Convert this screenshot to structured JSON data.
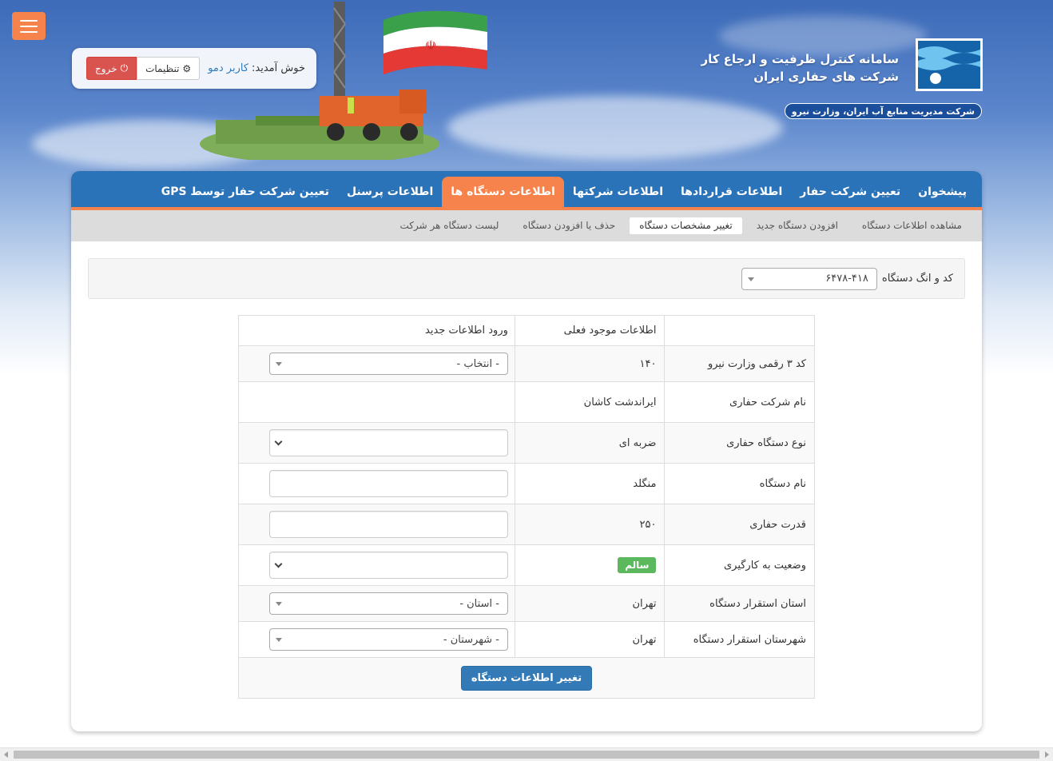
{
  "header": {
    "site_title_line1": "سامانه کنترل ظرفیت و ارجاع کار",
    "site_title_line2": "شرکت های حفاری ایران",
    "org_badge": "شرکت مدیریت منابع آب ایران، وزارت نیرو",
    "welcome_label": "خوش آمدید:",
    "user_name": "کاربر دمو",
    "settings_label": "تنظیمات",
    "exit_label": "خروج"
  },
  "nav": {
    "items": [
      {
        "label": "پیشخوان"
      },
      {
        "label": "تعیین شرکت حفار"
      },
      {
        "label": "اطلاعات قراردادها"
      },
      {
        "label": "اطلاعات شرکتها"
      },
      {
        "label": "اطلاعات دستگاه ها"
      },
      {
        "label": "اطلاعات پرسنل"
      },
      {
        "label": "تعیین شرکت حفار توسط GPS"
      }
    ],
    "active_index": 4
  },
  "subnav": {
    "items": [
      {
        "label": "مشاهده اطلاعات دستگاه"
      },
      {
        "label": "افزودن دستگاه جدید"
      },
      {
        "label": "تغییر مشخصات دستگاه"
      },
      {
        "label": "حذف یا افزودن دستگاه"
      },
      {
        "label": "لیست دستگاه هر شرکت"
      }
    ],
    "active_index": 2
  },
  "device_select": {
    "label": "کد و انگ دستگاه",
    "value": "۶۴۷۸-۴۱۸"
  },
  "table": {
    "headers": {
      "field": "",
      "current": "اطلاعات موجود فعلی",
      "new": "ورود اطلاعات جدید"
    },
    "rows": [
      {
        "field": "کد ۳ رقمی وزارت نیرو",
        "current": "۱۴۰",
        "input": "select",
        "placeholder": "- انتخاب -"
      },
      {
        "field": "نام شرکت حفاری",
        "current": "ایراندشت کاشان",
        "input": "none"
      },
      {
        "field": "نوع دستگاه حفاری",
        "current": "ضربه ای",
        "input": "dropdown"
      },
      {
        "field": "نام دستگاه",
        "current": "منگلد",
        "input": "text"
      },
      {
        "field": "قدرت حفاری",
        "current": "۲۵۰",
        "input": "text"
      },
      {
        "field": "وضعیت به کارگیری",
        "current": "سالم",
        "input": "dropdown"
      },
      {
        "field": "استان استقرار دستگاه",
        "current": "تهران",
        "input": "select",
        "placeholder": "- استان -"
      },
      {
        "field": "شهرستان استقرار دستگاه",
        "current": "تهران",
        "input": "select",
        "placeholder": "- شهرستان -"
      }
    ],
    "submit_label": "تغییر اطلاعات دستگاه"
  },
  "colors": {
    "nav_blue": "#2a73b8",
    "accent_orange": "#f7834c",
    "exit_red": "#d9534f",
    "ok_green": "#5cb85c",
    "submit_blue": "#337ab7"
  }
}
